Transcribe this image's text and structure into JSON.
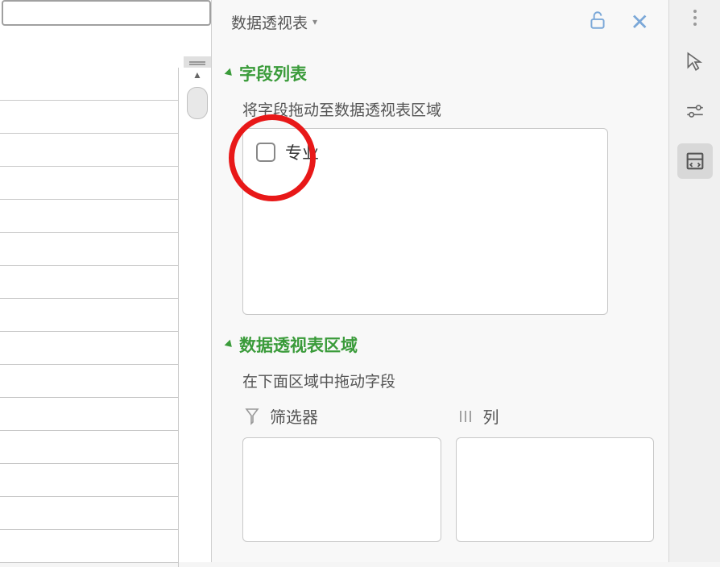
{
  "panel": {
    "title": "数据透视表",
    "dropdown_indicator": "▾"
  },
  "field_list": {
    "section_title": "字段列表",
    "hint": "将字段拖动至数据透视表区域",
    "items": [
      {
        "label": "专业",
        "checked": false
      }
    ]
  },
  "areas": {
    "section_title": "数据透视表区域",
    "hint": "在下面区域中拖动字段",
    "filter_label": "筛选器",
    "column_label": "列"
  },
  "annotation": {
    "color": "#e81818",
    "target": "field-item-0"
  }
}
